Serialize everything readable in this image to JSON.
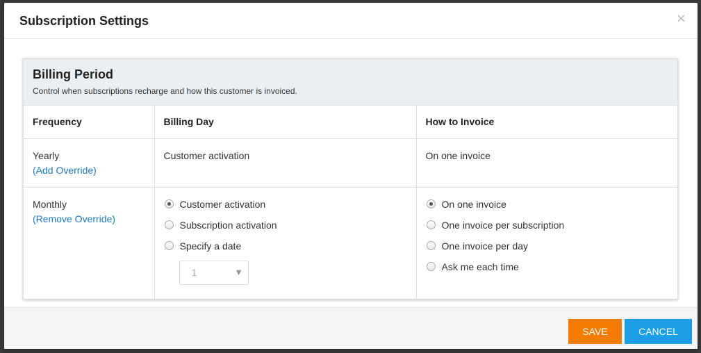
{
  "modal": {
    "title": "Subscription Settings",
    "close_glyph": "×"
  },
  "panel": {
    "title": "Billing Period",
    "subtitle": "Control when subscriptions recharge and how this customer is invoiced."
  },
  "table": {
    "headers": [
      "Frequency",
      "Billing Day",
      "How to Invoice"
    ],
    "rows": [
      {
        "frequency": "Yearly",
        "link": "(Add Override)",
        "billing_day": "Customer activation",
        "invoice": "On one invoice"
      },
      {
        "frequency": "Monthly",
        "link": "(Remove Override)",
        "billing_day_options": [
          {
            "label": "Customer activation",
            "checked": true
          },
          {
            "label": "Subscription activation",
            "checked": false
          },
          {
            "label": "Specify a date",
            "checked": false
          }
        ],
        "date_select": {
          "value": "1",
          "arrow": "▼"
        },
        "invoice_options": [
          {
            "label": "On one invoice",
            "checked": true
          },
          {
            "label": "One invoice per subscription",
            "checked": false
          },
          {
            "label": "One invoice per day",
            "checked": false
          },
          {
            "label": "Ask me each time",
            "checked": false
          }
        ]
      }
    ]
  },
  "footer": {
    "save_label": "SAVE",
    "cancel_label": "CANCEL"
  },
  "colors": {
    "save": "#f57c00",
    "cancel": "#1a9ee6",
    "link": "#1e7ac0",
    "panel_head": "#eceff2"
  }
}
